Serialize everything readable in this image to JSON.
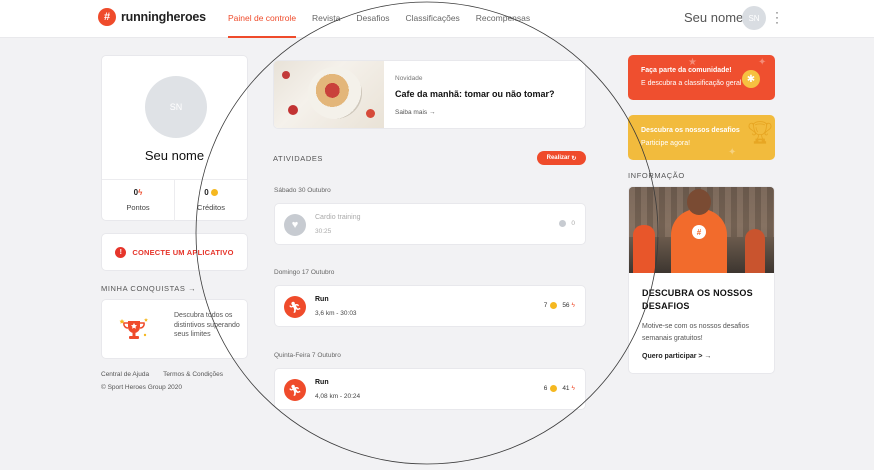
{
  "header": {
    "logo_text": "runningheroes",
    "nav": [
      "Painel de controle",
      "Revista",
      "Desafios",
      "Classificações",
      "Recompensas"
    ],
    "user_name": "Seu nome",
    "user_initials": "SN"
  },
  "profile": {
    "initials": "SN",
    "name": "Seu nome",
    "points_value": "0",
    "points_label": "Pontos",
    "credits_value": "0",
    "credits_label": "Créditos"
  },
  "connect": {
    "label": "CONECTE UM APLICATIVO"
  },
  "conquistas": {
    "label": "MINHA CONQUISTAS →",
    "text": "Descubra todos os distintivos superando seus limites"
  },
  "footer": {
    "help": "Central de Ajuda",
    "terms": "Termos & Condições",
    "copyright": "© Sport Heroes Group 2020"
  },
  "news": {
    "tag": "Novidade",
    "title": "Cafe da manhã: tomar ou não tomar?",
    "more": "Saiba mais →"
  },
  "activities": {
    "label": "ATIVIDADES",
    "button": "Realizar",
    "groups": [
      {
        "date": "Sábado 30 Outubro",
        "title": "Cardio training",
        "sub": "30:25",
        "coins": "",
        "points": "0"
      },
      {
        "date": "Domingo 17 Outubro",
        "title": "Run",
        "sub": "3,6 km - 30:03",
        "coins": "7",
        "points": "56"
      },
      {
        "date": "Quinta-Feira 7 Outubro",
        "title": "Run",
        "sub": "4,08 km - 20:24",
        "coins": "6",
        "points": "41"
      }
    ]
  },
  "promos": {
    "community_title": "Faça parte da comunidade!",
    "community_sub": "E descubra a classificação geral",
    "challenge_title": "Descubra os nossos desafios",
    "challenge_sub": "Participe agora!"
  },
  "info": {
    "label": "INFORMAÇÃO",
    "title": "DESCUBRA OS NOSSOS DESAFIOS",
    "text": "Motive-se com os nossos desafios semanais gratuitos!",
    "link": "Quero participar > →"
  },
  "colors": {
    "accent": "#ef4b2b",
    "gold": "#f5b820",
    "background": "#f2f2f4"
  }
}
